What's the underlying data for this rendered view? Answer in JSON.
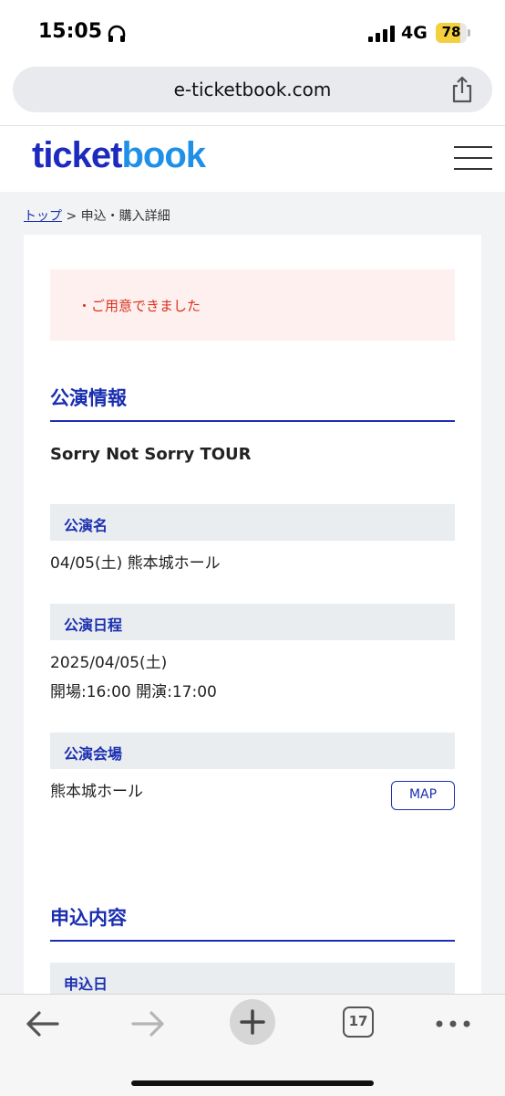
{
  "status_bar": {
    "time": "15:05",
    "network": "4G",
    "battery": "78",
    "battery_level_percent": 78
  },
  "browser": {
    "url": "e-ticketbook.com",
    "tab_count": "17"
  },
  "site": {
    "logo_part1": "ticket",
    "logo_part2": "book"
  },
  "breadcrumb": {
    "home": "トップ",
    "separator": ">",
    "current": "申込・購入詳細"
  },
  "alert": {
    "message": "・ご用意できました"
  },
  "event_info": {
    "section_title": "公演情報",
    "tour_name": "Sorry Not Sorry TOUR",
    "name_label": "公演名",
    "name_value": "04/05(土) 熊本城ホール",
    "schedule_label": "公演日程",
    "schedule_date": "2025/04/05(土)",
    "schedule_times": "開場:16:00 開演:17:00",
    "venue_label": "公演会場",
    "venue_value": "熊本城ホール",
    "map_button": "MAP"
  },
  "application": {
    "section_title": "申込内容",
    "date_label": "申込日"
  },
  "colors": {
    "brand_dark": "#1c2bbd",
    "brand_light": "#1e90e8",
    "alert_text": "#d9321d",
    "alert_bg": "#fdf0ee"
  }
}
